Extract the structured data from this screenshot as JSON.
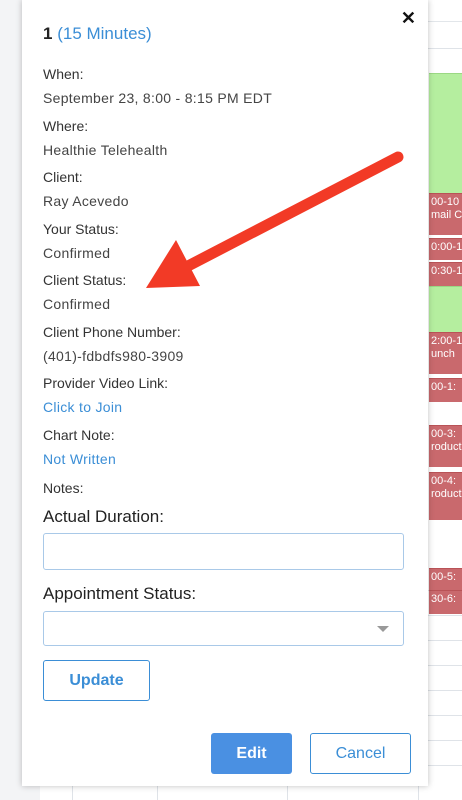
{
  "modal": {
    "title_number": "1",
    "title_duration": "(15 Minutes)",
    "close_glyph": "✕",
    "fields": {
      "when_label": "When:",
      "when_value": "September 23, 8:00 - 8:15 PM EDT",
      "where_label": "Where:",
      "where_value": "Healthie Telehealth",
      "client_label": "Client:",
      "client_value": "Ray Acevedo",
      "your_status_label": "Your Status:",
      "your_status_value": "Confirmed",
      "client_status_label": "Client Status:",
      "client_status_value": "Confirmed",
      "phone_label": "Client Phone Number:",
      "phone_value": "(401)-fdbdfs980-3909",
      "video_label": "Provider Video Link:",
      "video_link": "Click to Join",
      "chart_label": "Chart Note:",
      "chart_link": "Not Written",
      "notes_label": "Notes:"
    },
    "actual_duration_label": "Actual Duration:",
    "actual_duration_value": "",
    "appointment_status_label": "Appointment Status:",
    "appointment_status_value": "",
    "update_label": "Update",
    "edit_label": "Edit",
    "cancel_label": "Cancel"
  },
  "calendar": {
    "blocks": [
      {
        "text": "",
        "color": "green"
      },
      {
        "text": "00-10",
        "sub": "mail C",
        "color": "red"
      },
      {
        "text": "0:00-1",
        "color": "red"
      },
      {
        "text": "0:30-1",
        "color": "red"
      },
      {
        "text": "",
        "color": "green"
      },
      {
        "text": "2:00-1",
        "sub": "unch",
        "color": "red"
      },
      {
        "text": "00-1:",
        "color": "red"
      },
      {
        "text": "00-3:",
        "sub": "roduct",
        "color": "red"
      },
      {
        "text": "00-4:",
        "sub": "roduct",
        "color": "red"
      },
      {
        "text": "00-5:",
        "color": "red"
      },
      {
        "text": "30-6:",
        "color": "red"
      }
    ]
  },
  "colors": {
    "accent": "#3b8ed6",
    "primary_button": "#4a90e2",
    "arrow": "#f23a26",
    "event_green": "#b5ee9f",
    "event_red": "#c9696d"
  }
}
